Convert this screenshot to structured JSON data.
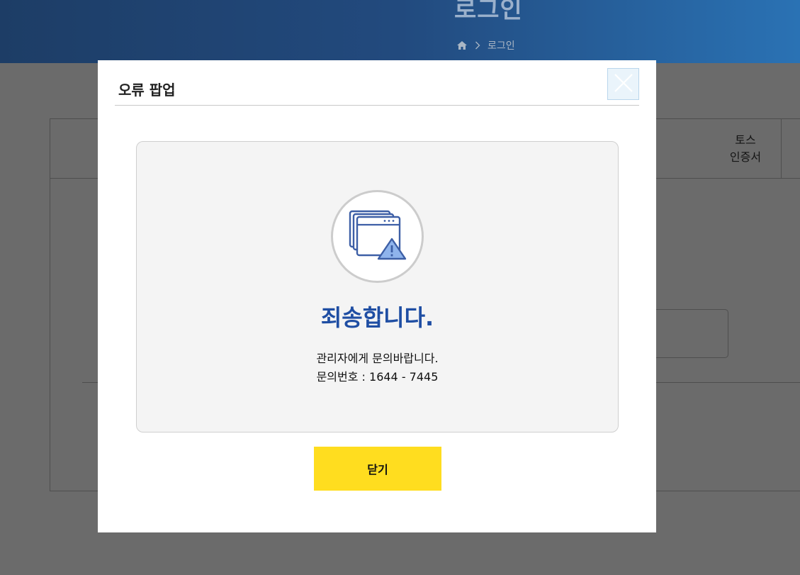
{
  "header": {
    "title": "로그인",
    "breadcrumb": {
      "home_icon": "home-icon",
      "separator_icon": "chevron-right-icon",
      "current": "로그인"
    }
  },
  "background": {
    "auth_tabs": [
      {
        "line1": "토스",
        "line2": "인증서"
      }
    ]
  },
  "modal": {
    "title": "오류 팝업",
    "close_icon": "close-icon",
    "illustration_icon": "browser-warning-icon",
    "headline": "죄송합니다.",
    "message_line1": "관리자에게 문의바랍니다.",
    "message_line2": "문의번호 : 1644 - 7445",
    "confirm_label": "닫기"
  },
  "colors": {
    "accent_blue": "#1f4ea3",
    "button_yellow": "#ffdd1f",
    "overlay": "#6b6b6b"
  }
}
